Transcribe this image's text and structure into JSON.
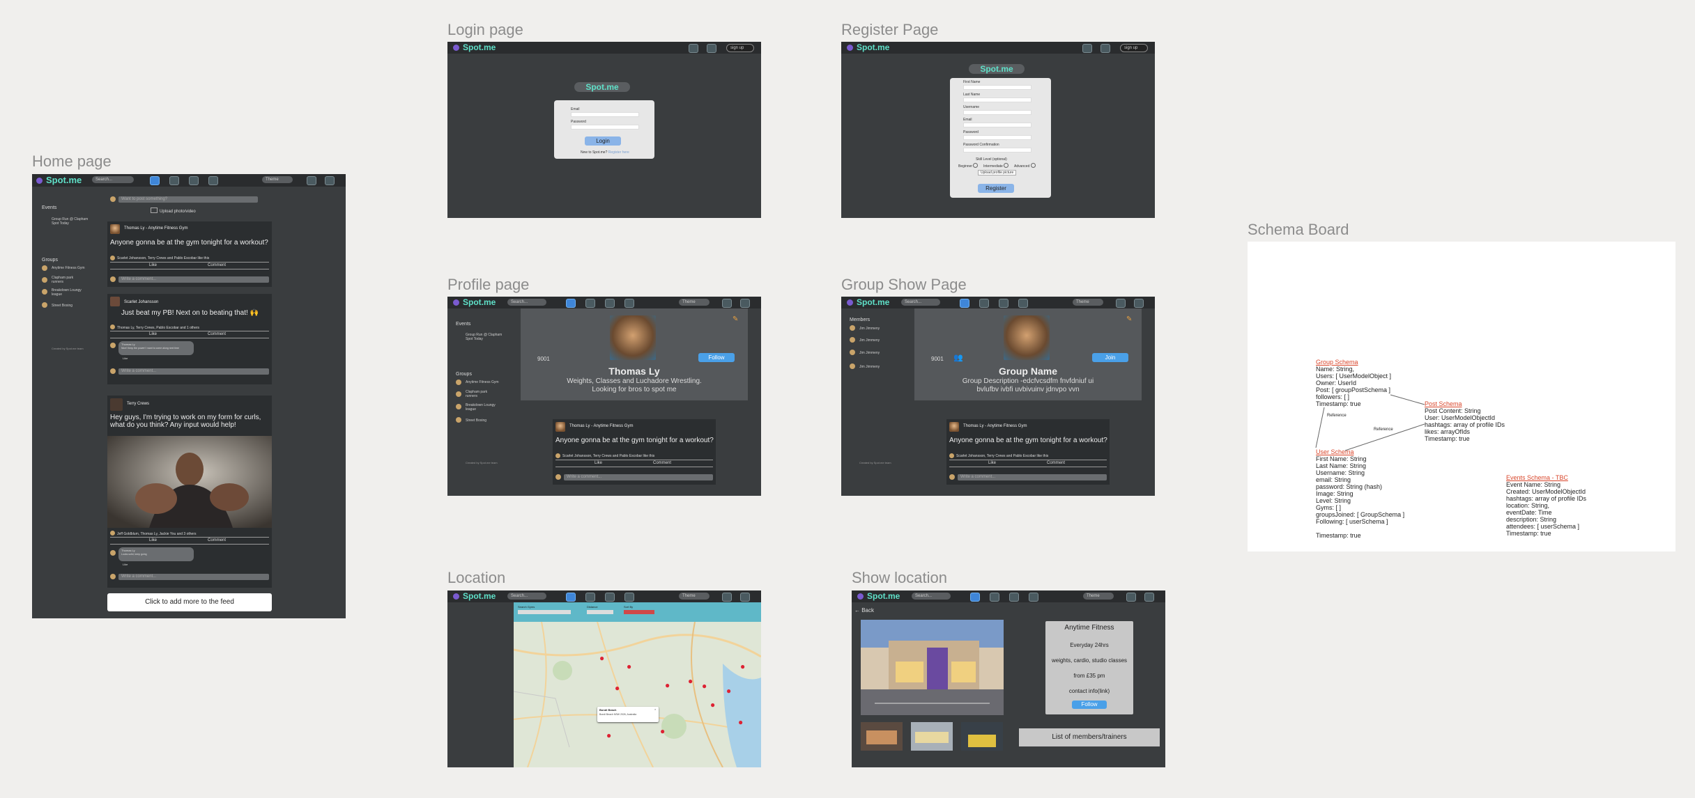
{
  "frames": {
    "home": "Home page",
    "login": "Login page",
    "register": "Register Page",
    "profile": "Profile page",
    "group_show": "Group Show Page",
    "location": "Location",
    "show_location": "Show location",
    "schema": "Schema Board"
  },
  "nav": {
    "brand": "Spot.me",
    "search": "Search...",
    "theme": "Theme",
    "signup": "sign up"
  },
  "home": {
    "events_heading": "Events",
    "event_item": "Group Run @ Clapham Spot Today",
    "groups_heading": "Groups",
    "groups": [
      "Anytime Fitness Gym",
      "Clapham park runners",
      "Breakdown Loungy league",
      "Street Boxing"
    ],
    "footer_note": "Created by Spot.me team",
    "composer_placeholder": "Want to post something?",
    "upload": "Upload photo/video",
    "posts": [
      {
        "author": "Thomas Ly - Anytime Fitness Gym",
        "text": "Anyone gonna be at the gym tonight for a workout?",
        "likes": "Scarlet Johansson, Terry Crews and Pablo Escobar like this",
        "comment_placeholder": "Write a comment..."
      },
      {
        "author": "Scarlet Johansson",
        "text": "Just beat my PB! Next on to beating that! 🙌",
        "likes": "Thomas Ly, Terry Crews, Pablo Escobar and 1 others",
        "comment_author": "Thomas Ly",
        "comment_text": "Nice! Keep the power! I want to come along next time",
        "comment_placeholder": "Write a comment..."
      },
      {
        "author": "Terry Crews",
        "text": "Hey guys, I'm trying to work on my form for curls, what do you think? Any input would help!",
        "likes": "Jeff Goldblum, Thomas Ly, Jackie You and 3 others",
        "comment_author": "Thomas Ly",
        "comment_text": "Looks solid, keep going",
        "comment_placeholder": "Write a comment..."
      }
    ],
    "like": "Like",
    "comment": "Comment",
    "reply": "Like",
    "add_more": "Click to add more to the feed"
  },
  "login": {
    "email": "Email",
    "password": "Password",
    "button": "Login",
    "new_text": "New to Spot.me?",
    "register_link": "Register here"
  },
  "register": {
    "fields": [
      "First Name",
      "Last Name",
      "Username",
      "Email",
      "Password",
      "Password Confirmation"
    ],
    "skill": "Skill Level (optional)",
    "levels": [
      "Beginner",
      "Intermediate",
      "Advanced"
    ],
    "upload": "Upload profile picture",
    "button": "Register"
  },
  "profile": {
    "name": "Thomas Ly",
    "bio": "Weights, Classes and Luchadore Wrestling.\nLooking for bros to spot me",
    "count": "9001",
    "follow": "Follow",
    "post_author": "Thomas Ly - Anytime Fitness Gym",
    "post_text": "Anyone gonna be at the gym tonight for a workout?",
    "likes": "Scarlet Johansson, Terry Crews and Pablo Escobar like this",
    "like": "Like",
    "comment": "Comment",
    "comment_placeholder": "Write a comment..."
  },
  "group_show": {
    "members_heading": "Members",
    "members": [
      "Jim Jimmeny",
      "Jim Jimmeny",
      "Jim Jimmeny",
      "Jim Jimmeny"
    ],
    "name": "Group Name",
    "description": "Group Description -edcfvcsdfm fnvfdniuf ui\nbvlufbv ivbfi uvbivuinv jdnvpo vvn",
    "count": "9001",
    "join": "Join",
    "post_author": "Thomas Ly - Anytime Fitness Gym",
    "post_text": "Anyone gonna be at the gym tonight for a workout?",
    "likes": "Scarlet Johansson, Terry Crews and Pablo Escobar like this",
    "like": "Like",
    "comment": "Comment",
    "comment_placeholder": "Write a comment..."
  },
  "location": {
    "filters": [
      "Search Gyms",
      "Distance",
      "Sort By"
    ],
    "popup_title": "Bondi Beach",
    "popup_text": "Bondi Beach NSW 2026, Australia"
  },
  "show_location": {
    "back": "← Back",
    "name": "Anytime Fitness",
    "hours": "Everyday 24hrs",
    "features": "weights, cardio, studio classes",
    "price": "from £35 pm",
    "contact": "contact info(link)",
    "follow": "Follow",
    "members": "List of members/trainers"
  },
  "schema": {
    "group_title": "Group Schema",
    "group_body": "Name: String,\nUsers: [ UserModelObject ]\nOwner: UserId\nPost: [ groupPostSchema ]\nfollowers: [ ]\nTimestamp: true",
    "post_title": "Post Schema",
    "post_body": "Post Content: String\nUser: UserModelObjectId\nhashtags: array of profile IDs\nlikes: arrayOfIds\nTimestamp: true",
    "user_title": "User Schema",
    "user_body": "First Name: String\nLast Name: String\nUsername: String\nemail: String\npassword: String (hash)\nImage: String\nLevel: String\nGyms: [ ]\ngroupsJoined: [ GroupSchema ]\nFollowing: [ userSchema ]\n\nTimestamp: true",
    "events_title": "Events Schema - TBC",
    "events_body": "Event Name: String\nCreated: UserModelObjectId\nhashtags: array of profile IDs\nlocation: String,\neventDate: Time\ndescription: String\nattendees: [ userSchema ]\nTimestamp: true",
    "reference": "Reference"
  }
}
